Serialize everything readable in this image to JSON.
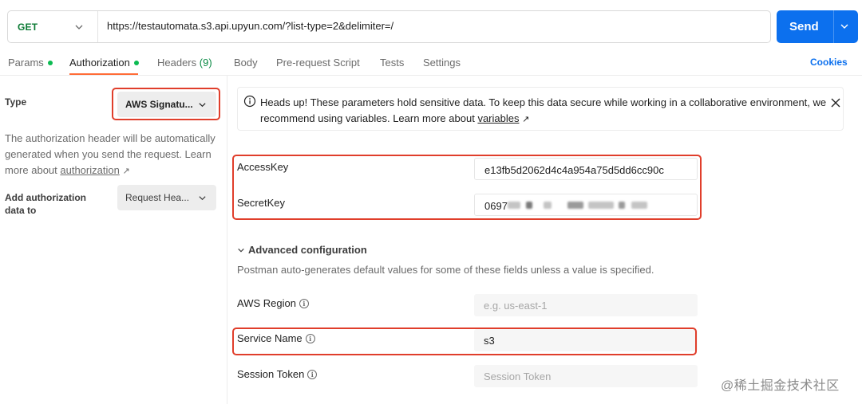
{
  "request": {
    "method": "GET",
    "url": "https://testautomata.s3.api.upyun.com/?list-type=2&delimiter=/",
    "send_label": "Send"
  },
  "tabs": {
    "params": "Params",
    "authorization": "Authorization",
    "headers_label": "Headers",
    "headers_count": "(9)",
    "body": "Body",
    "prerequest": "Pre-request Script",
    "tests": "Tests",
    "settings": "Settings",
    "cookies": "Cookies"
  },
  "auth": {
    "type_label": "Type",
    "type_value": "AWS Signatu...",
    "description": "The authorization header will be automatically generated when you send the request. Learn more about ",
    "description_link": "authorization",
    "add_to_label": "Add authorization data to",
    "add_to_value": "Request Hea..."
  },
  "banner": {
    "text": "Heads up! These parameters hold sensitive data. To keep this data secure while working in a collaborative environment, we recommend using variables. Learn more about ",
    "link": "variables"
  },
  "fields": {
    "access_key_label": "AccessKey",
    "access_key_value": "e13fb5d2062d4c4a954a75d5dd6cc90c",
    "secret_key_label": "SecretKey",
    "secret_key_visible": "0697",
    "advanced_title": "Advanced configuration",
    "advanced_desc": "Postman auto-generates default values for some of these fields unless a value is specified.",
    "region_label": "AWS Region",
    "region_placeholder": "e.g. us-east-1",
    "service_label": "Service Name",
    "service_value": "s3",
    "session_label": "Session Token",
    "session_placeholder": "Session Token"
  },
  "watermark": "@稀土掘金技术社区",
  "colors": {
    "accent_blue": "#0c70ee",
    "method_green": "#0b7a34",
    "active_dot": "#0cbb52",
    "tab_underline": "#ff6c37",
    "highlight_red": "#e03e2b"
  }
}
